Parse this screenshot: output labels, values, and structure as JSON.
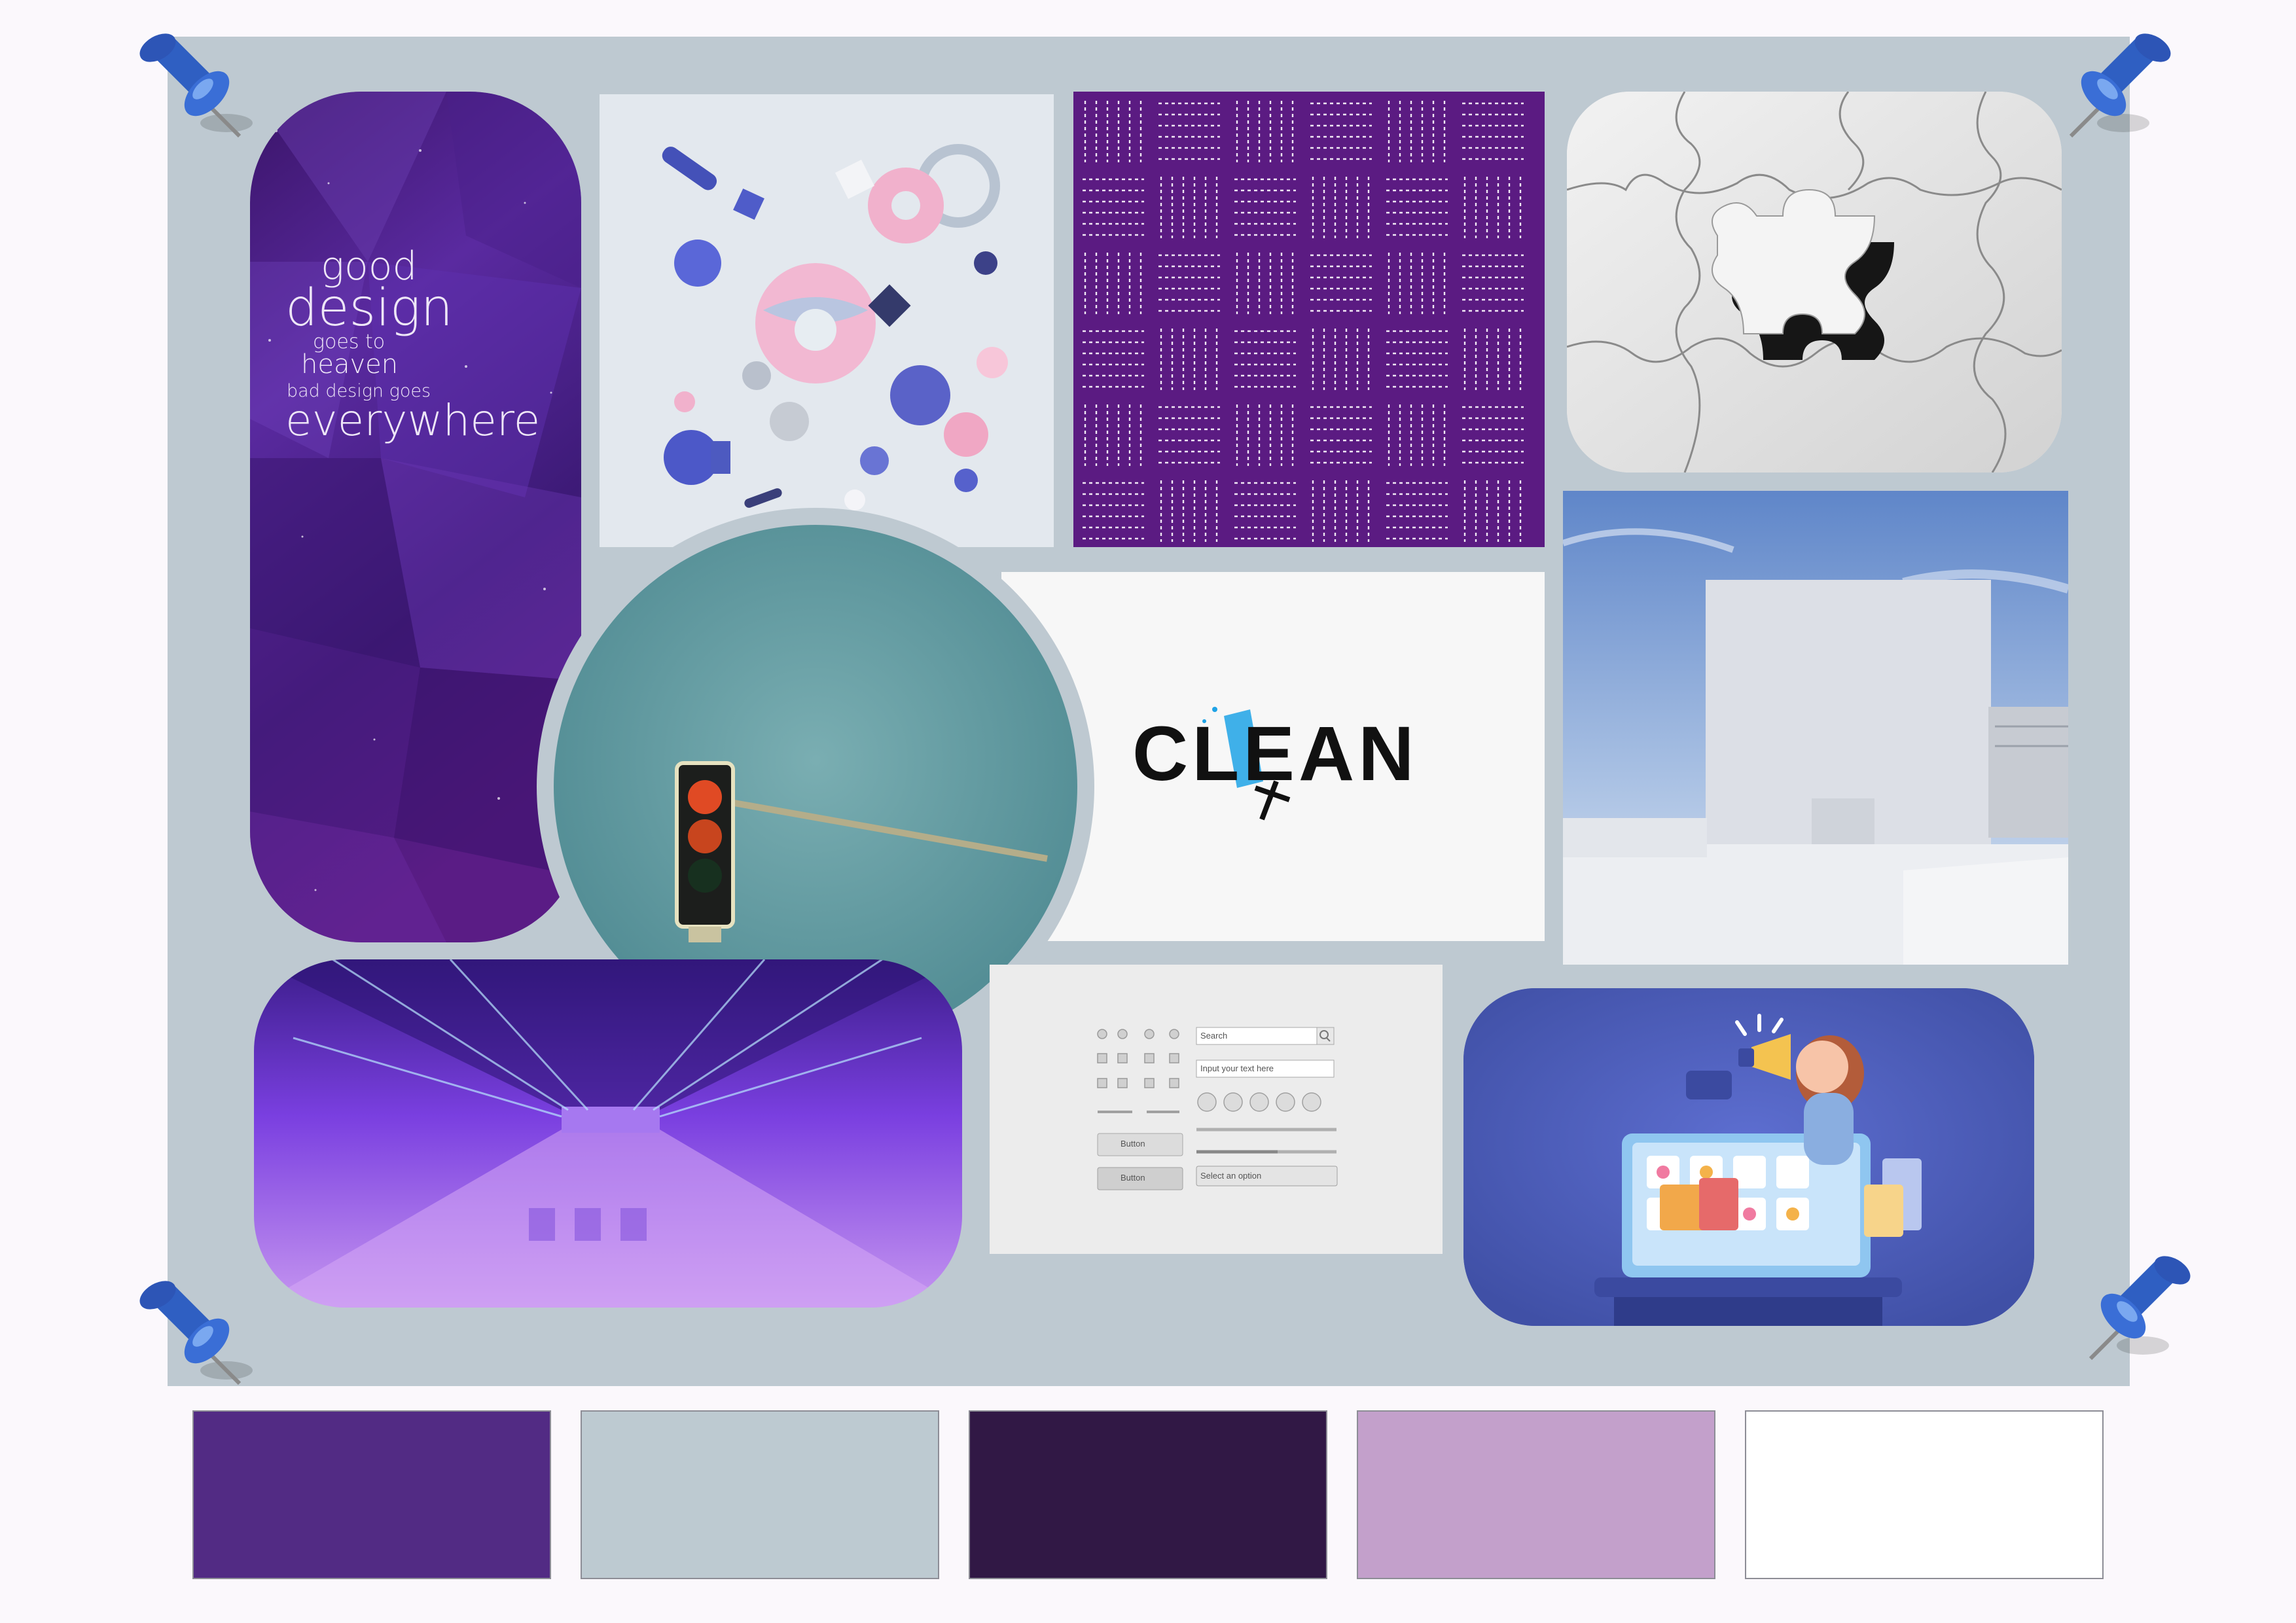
{
  "quote": {
    "line1": "good",
    "line2": "design",
    "line3": "goes to",
    "line4": "heaven",
    "line5": "bad design goes",
    "line6": "everywhere"
  },
  "clean_tile": {
    "word": "CLEAN"
  },
  "ui_kit": {
    "search_placeholder": "Search",
    "text_placeholder": "Input your text here",
    "button1_label": "Button",
    "button2_label": "Button",
    "select_label": "Select an option"
  },
  "palette": {
    "colors": [
      "#522b84",
      "#bdcad1",
      "#311845",
      "#c3a0cb",
      "#ffffff"
    ]
  },
  "icons": [
    "pushpin-icon",
    "search-icon",
    "media-controls-icon",
    "megaphone-icon"
  ]
}
